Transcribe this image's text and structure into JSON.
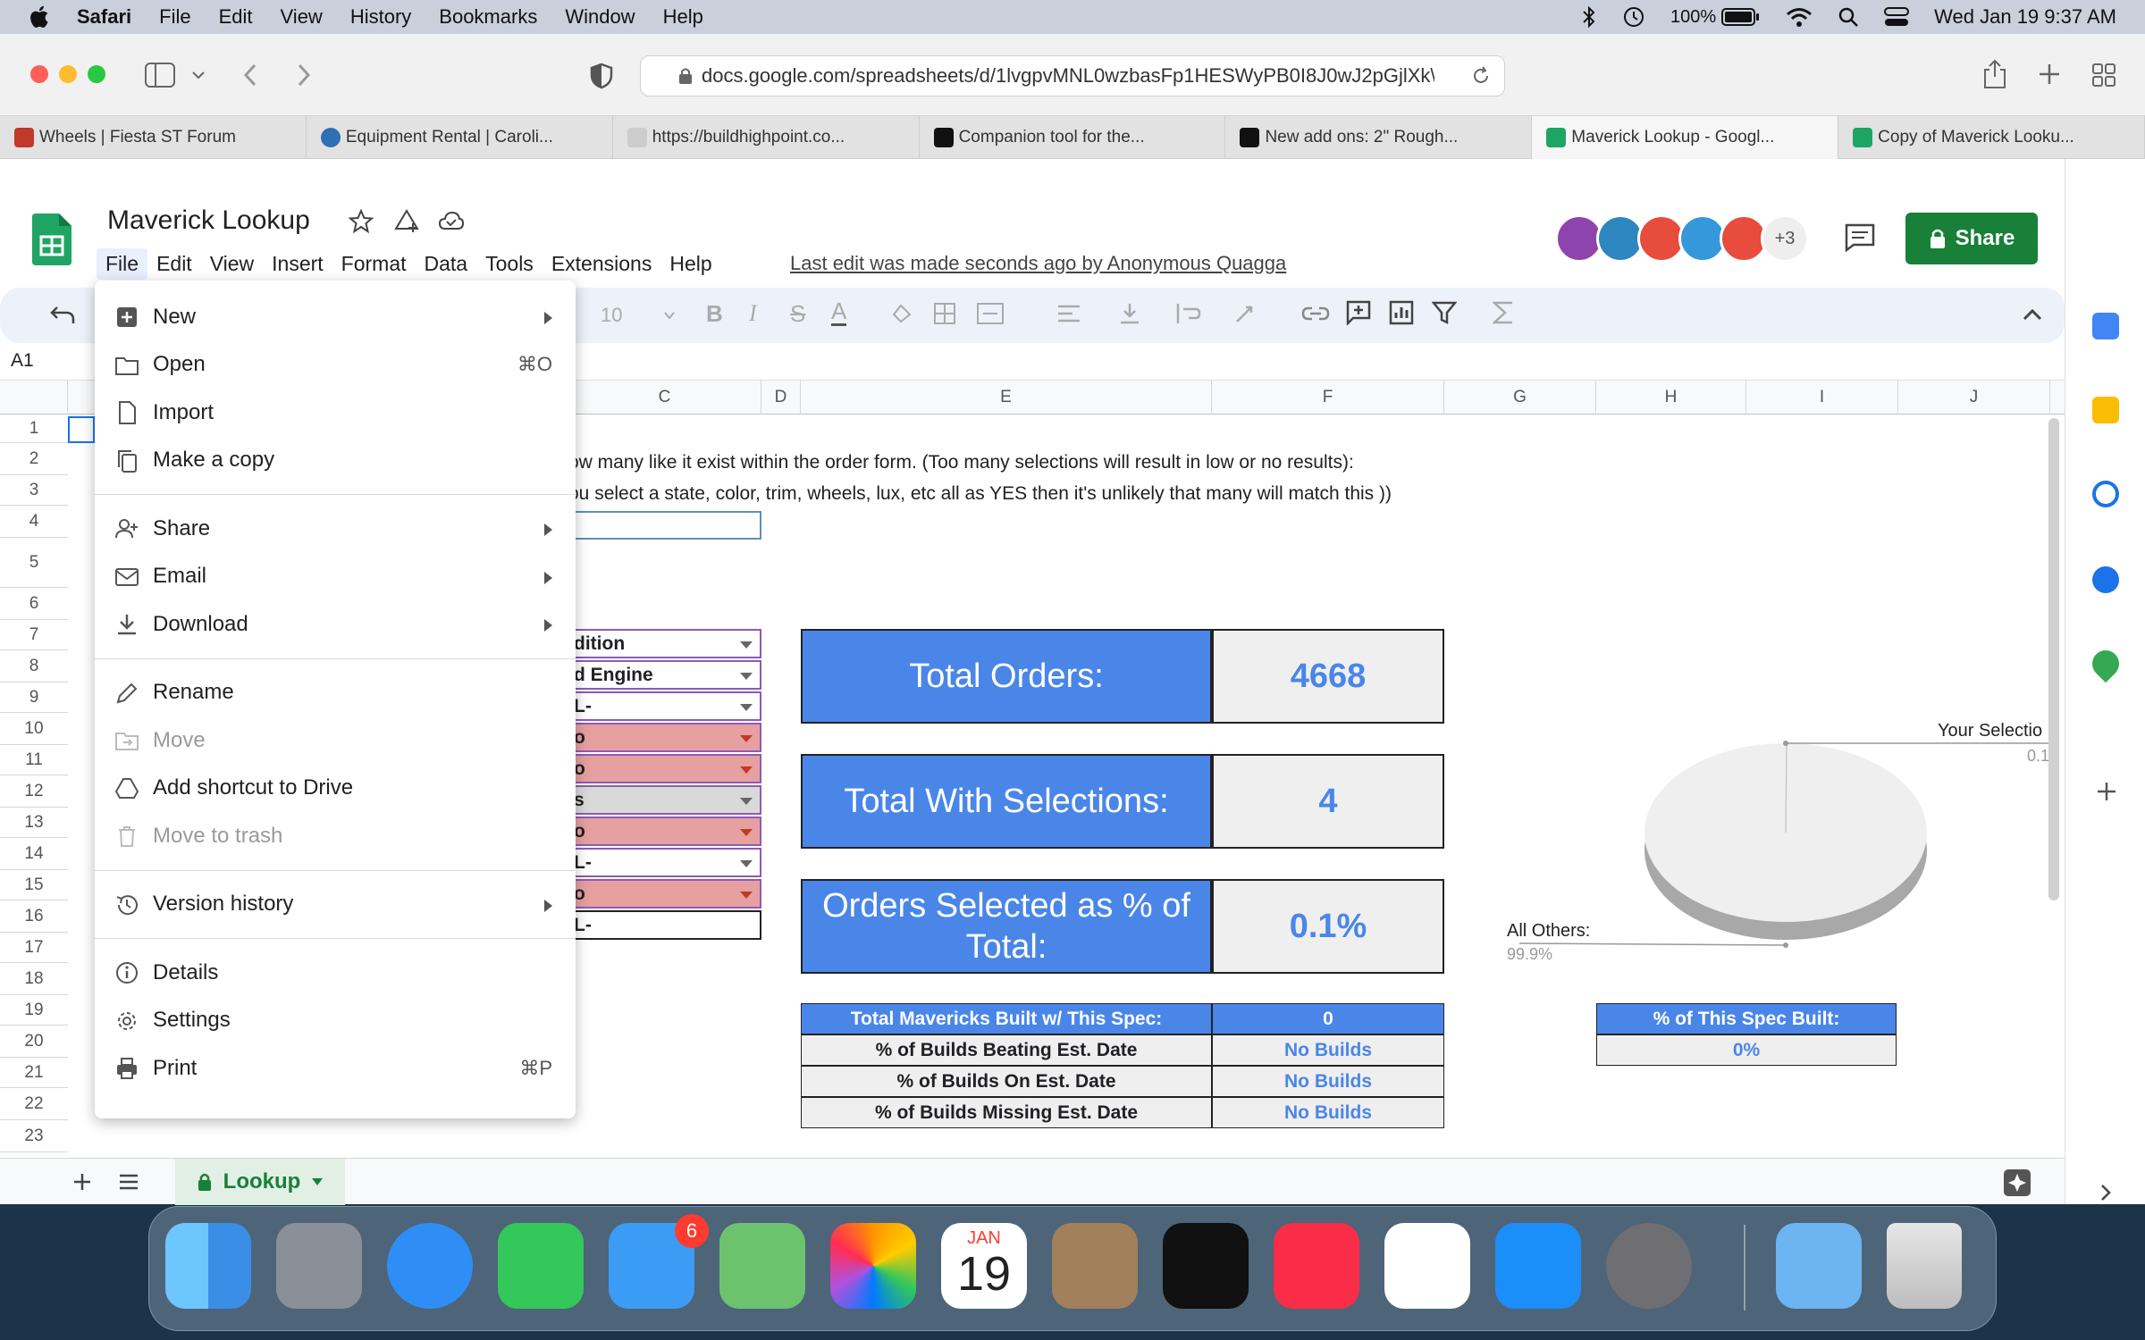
{
  "menubar": {
    "app": "Safari",
    "items": [
      "File",
      "Edit",
      "View",
      "History",
      "Bookmarks",
      "Window",
      "Help"
    ],
    "battery": "100%",
    "datetime": "Wed Jan 19  9:37 AM"
  },
  "browser": {
    "url": "docs.google.com/spreadsheets/d/1lvgpvMNL0wzbasFp1HESWyPB0I8J0wJ2pGjlXk\\",
    "tabs": [
      {
        "label": "Wheels | Fiesta ST Forum",
        "color": "#c0392b"
      },
      {
        "label": "Equipment Rental | Caroli...",
        "color": "#2e6fb5"
      },
      {
        "label": "https://buildhighpoint.co...",
        "color": "#333333"
      },
      {
        "label": "Companion tool for the...",
        "color": "#111111"
      },
      {
        "label": "New add ons: 2\" Rough...",
        "color": "#111111"
      },
      {
        "label": "Maverick Lookup - Googl...",
        "color": "#1fa463"
      },
      {
        "label": "Copy of Maverick Looku...",
        "color": "#1fa463"
      }
    ]
  },
  "doc": {
    "title": "Maverick Lookup",
    "menu": [
      "File",
      "Edit",
      "View",
      "Insert",
      "Format",
      "Data",
      "Tools",
      "Extensions",
      "Help"
    ],
    "last_edit": "Last edit was made seconds ago by Anonymous Quagga",
    "share_label": "Share",
    "avatars_more": "+3",
    "font_size": "10",
    "cell_ref": "A1"
  },
  "grid": {
    "columns": [
      "C",
      "D",
      "E",
      "F",
      "G",
      "H",
      "I",
      "J"
    ],
    "rows": [
      "1",
      "2",
      "3",
      "4",
      "5",
      "6",
      "7",
      "8",
      "9",
      "10",
      "11",
      "12",
      "13",
      "14",
      "15",
      "16",
      "17",
      "18",
      "19",
      "20",
      "21",
      "22",
      "23"
    ],
    "line2": "ow many like it exist within the order form.  (Too many selections will result in low or no results):",
    "line3": "ou select a state, color, trim, wheels, lux, etc all as YES then it's unlikely that many will match this ))",
    "dropdowns": [
      "dition",
      "d Engine",
      "L-",
      "o",
      "o",
      "s",
      "o",
      "L-",
      "o",
      "L-"
    ]
  },
  "summary": {
    "total_orders_label": "Total Orders:",
    "total_orders_value": "4668",
    "with_selections_label": "Total With Selections:",
    "with_selections_value": "4",
    "pct_label": "Orders Selected as % of Total:",
    "pct_value": "0.1%"
  },
  "builds_table": {
    "rows": [
      {
        "label": "Total Mavericks Built w/ This Spec:",
        "value": "0"
      },
      {
        "label": "% of Builds Beating Est. Date",
        "value": "No Builds"
      },
      {
        "label": "% of Builds On Est. Date",
        "value": "No Builds"
      },
      {
        "label": "% of Builds Missing Est. Date",
        "value": "No Builds"
      }
    ],
    "spec_header": "% of This Spec Built:",
    "spec_value": "0%"
  },
  "pie": {
    "your_selection_label": "Your Selectio",
    "your_selection_value": "0.1",
    "all_others_label": "All Others:",
    "all_others_value": "99.9%"
  },
  "chart_data": {
    "type": "pie",
    "categories": [
      "Your Selection",
      "All Others"
    ],
    "values": [
      0.1,
      99.9
    ]
  },
  "file_menu": {
    "items": [
      {
        "label": "New",
        "shortcut": "",
        "submenu": true,
        "disabled": false,
        "icon": "new-sheet-icon"
      },
      {
        "label": "Open",
        "shortcut": "⌘O",
        "submenu": false,
        "disabled": false,
        "icon": "folder-icon"
      },
      {
        "label": "Import",
        "shortcut": "",
        "submenu": false,
        "disabled": false,
        "icon": "import-file-icon"
      },
      {
        "label": "Make a copy",
        "shortcut": "",
        "submenu": false,
        "disabled": false,
        "icon": "copy-icon"
      },
      {
        "label": "Share",
        "shortcut": "",
        "submenu": true,
        "disabled": false,
        "icon": "share-person-icon"
      },
      {
        "label": "Email",
        "shortcut": "",
        "submenu": true,
        "disabled": false,
        "icon": "email-icon"
      },
      {
        "label": "Download",
        "shortcut": "",
        "submenu": true,
        "disabled": false,
        "icon": "download-icon"
      },
      {
        "label": "Rename",
        "shortcut": "",
        "submenu": false,
        "disabled": false,
        "icon": "rename-icon"
      },
      {
        "label": "Move",
        "shortcut": "",
        "submenu": false,
        "disabled": true,
        "icon": "move-icon"
      },
      {
        "label": "Add shortcut to Drive",
        "shortcut": "",
        "submenu": false,
        "disabled": false,
        "icon": "drive-shortcut-icon"
      },
      {
        "label": "Move to trash",
        "shortcut": "",
        "submenu": false,
        "disabled": true,
        "icon": "trash-icon"
      },
      {
        "label": "Version history",
        "shortcut": "",
        "submenu": true,
        "disabled": false,
        "icon": "history-icon"
      },
      {
        "label": "Details",
        "shortcut": "",
        "submenu": false,
        "disabled": false,
        "icon": "info-icon"
      },
      {
        "label": "Settings",
        "shortcut": "",
        "submenu": false,
        "disabled": false,
        "icon": "gear-icon"
      },
      {
        "label": "Print",
        "shortcut": "⌘P",
        "submenu": false,
        "disabled": false,
        "icon": "print-icon"
      }
    ]
  },
  "sheet_tab": {
    "label": "Lookup"
  },
  "dock": {
    "mail_badge": "6",
    "calendar_month": "JAN",
    "calendar_day": "19"
  },
  "colors": {
    "sheets_green": "#188038",
    "accent_blue": "#4a86e8",
    "value_grey": "#efefef"
  }
}
